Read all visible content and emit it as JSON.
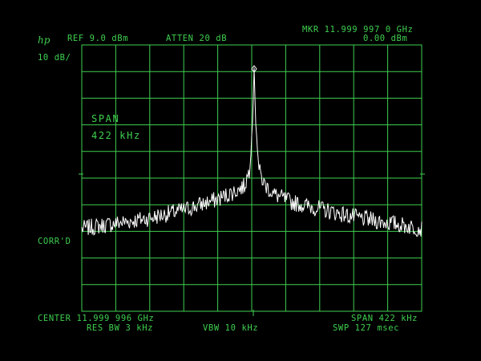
{
  "instrument": {
    "logo": "hp",
    "colors": {
      "graticule": "#3fcf4f",
      "trace": "#ffffff",
      "background": "#000000"
    }
  },
  "header": {
    "ref_level": "REF  9.0 dBm",
    "atten": "ATTEN 20 dB",
    "marker_freq": "MKR 11.999 997 0 GHz",
    "marker_level": "0.00 dBm",
    "scale": "10 dB/"
  },
  "overlay": {
    "span_title": "SPAN",
    "span_value": "422  kHz",
    "corr": "CORR'D"
  },
  "footer": {
    "center": "CENTER 11.999 996 GHz",
    "span": "SPAN 422 kHz",
    "res_bw": "RES BW 3 kHz",
    "vbw": "VBW 10 kHz",
    "sweep": "SWP 127 msec"
  },
  "chart_data": {
    "type": "line",
    "x_unit": "GHz",
    "y_unit": "dBm",
    "xlim": [
      11.999785,
      12.000207
    ],
    "ylim": [
      -91.0,
      9.0
    ],
    "grid": true,
    "series": [
      {
        "x": [
          11.999785,
          11.999827,
          11.999869,
          11.999911,
          11.999953,
          11.999975,
          11.999987,
          11.999993,
          11.999997,
          11.999999,
          12.000001,
          12.000005,
          12.000011,
          12.000023,
          12.000045,
          12.000087,
          12.000129,
          12.000171,
          12.000207
        ],
        "y": [
          -60,
          -58,
          -56,
          -53,
          -49,
          -46,
          -44,
          -38,
          -20,
          0,
          -20,
          -38,
          -43,
          -47,
          -50,
          -53,
          -56,
          -58,
          -60
        ]
      }
    ]
  }
}
